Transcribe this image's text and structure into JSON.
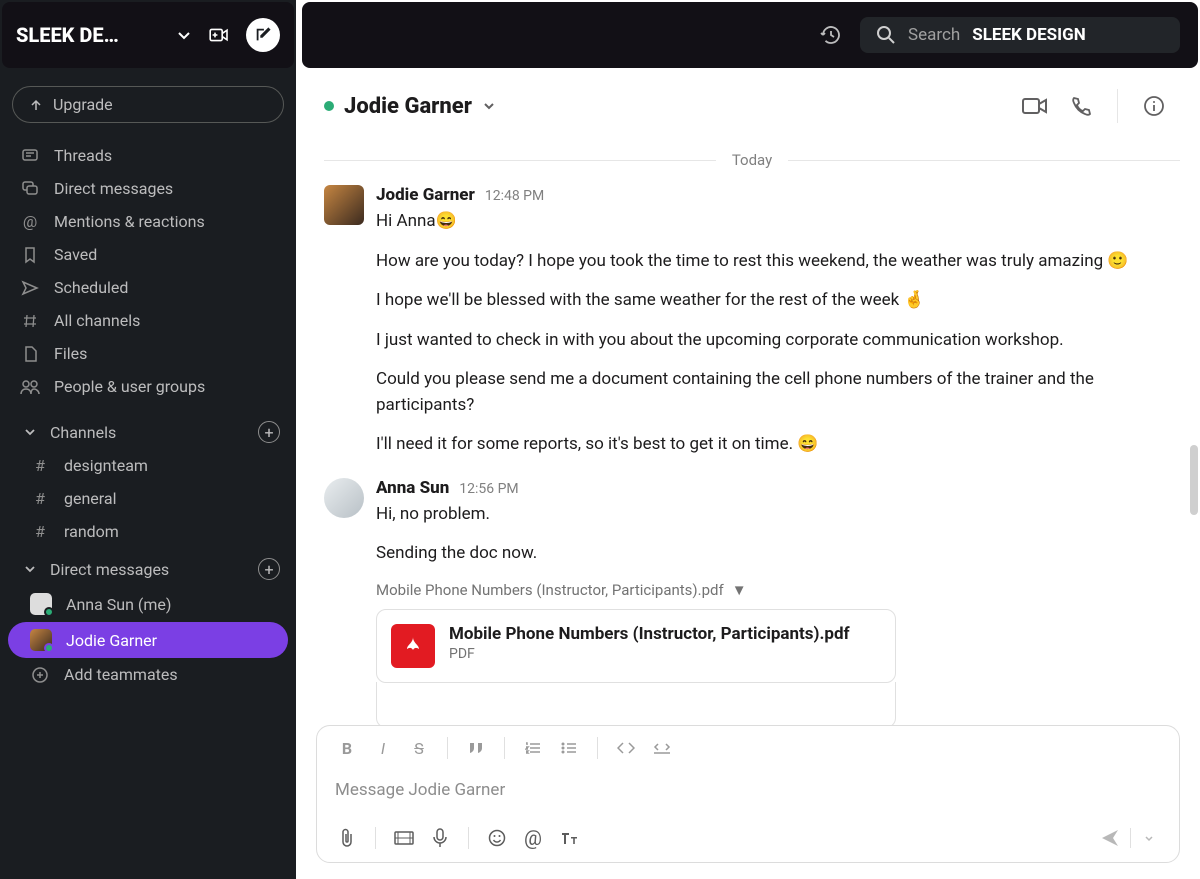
{
  "workspace": {
    "name": "SLEEK DE…"
  },
  "upgrade_label": "Upgrade",
  "nav": [
    {
      "label": "Threads",
      "icon": "threads-icon"
    },
    {
      "label": "Direct messages",
      "icon": "dm-icon"
    },
    {
      "label": "Mentions & reactions",
      "icon": "mentions-icon"
    },
    {
      "label": "Saved",
      "icon": "bookmark-icon"
    },
    {
      "label": "Scheduled",
      "icon": "scheduled-icon"
    },
    {
      "label": "All channels",
      "icon": "all-channels-icon"
    },
    {
      "label": "Files",
      "icon": "files-icon"
    },
    {
      "label": "People & user groups",
      "icon": "people-icon"
    }
  ],
  "sections": {
    "channels": {
      "label": "Channels",
      "items": [
        "designteam",
        "general",
        "random"
      ]
    },
    "dms": {
      "label": "Direct messages",
      "items": [
        {
          "name": "Anna Sun (me)",
          "active": false
        },
        {
          "name": "Jodie Garner",
          "active": true
        }
      ],
      "add_label": "Add teammates"
    }
  },
  "search": {
    "placeholder": "Search",
    "target": "SLEEK DESIGN"
  },
  "chat": {
    "title": "Jodie Garner",
    "divider": "Today",
    "messages": [
      {
        "sender": "Jodie Garner",
        "time": "12:48 PM",
        "avatar": "jodie",
        "lines": [
          "Hi Anna😄",
          "How are you today? I hope you took the time to rest this weekend, the weather was truly amazing 🙂",
          "I hope we'll be blessed with the same weather for the rest of the week 🤞",
          "I just wanted to check in with you about the upcoming corporate communication workshop.",
          "Could you please send me a document containing the cell phone numbers of the trainer and the participants?",
          "I'll need it for some reports, so it's best to get it on time. 😄"
        ]
      },
      {
        "sender": "Anna Sun",
        "time": "12:56 PM",
        "avatar": "anna",
        "lines": [
          "Hi, no problem.",
          "Sending the doc now."
        ],
        "attachment": {
          "label": "Mobile Phone Numbers (Instructor, Participants).pdf",
          "name": "Mobile Phone Numbers (Instructor, Participants).pdf",
          "type": "PDF"
        }
      }
    ]
  },
  "composer": {
    "placeholder": "Message Jodie Garner"
  }
}
